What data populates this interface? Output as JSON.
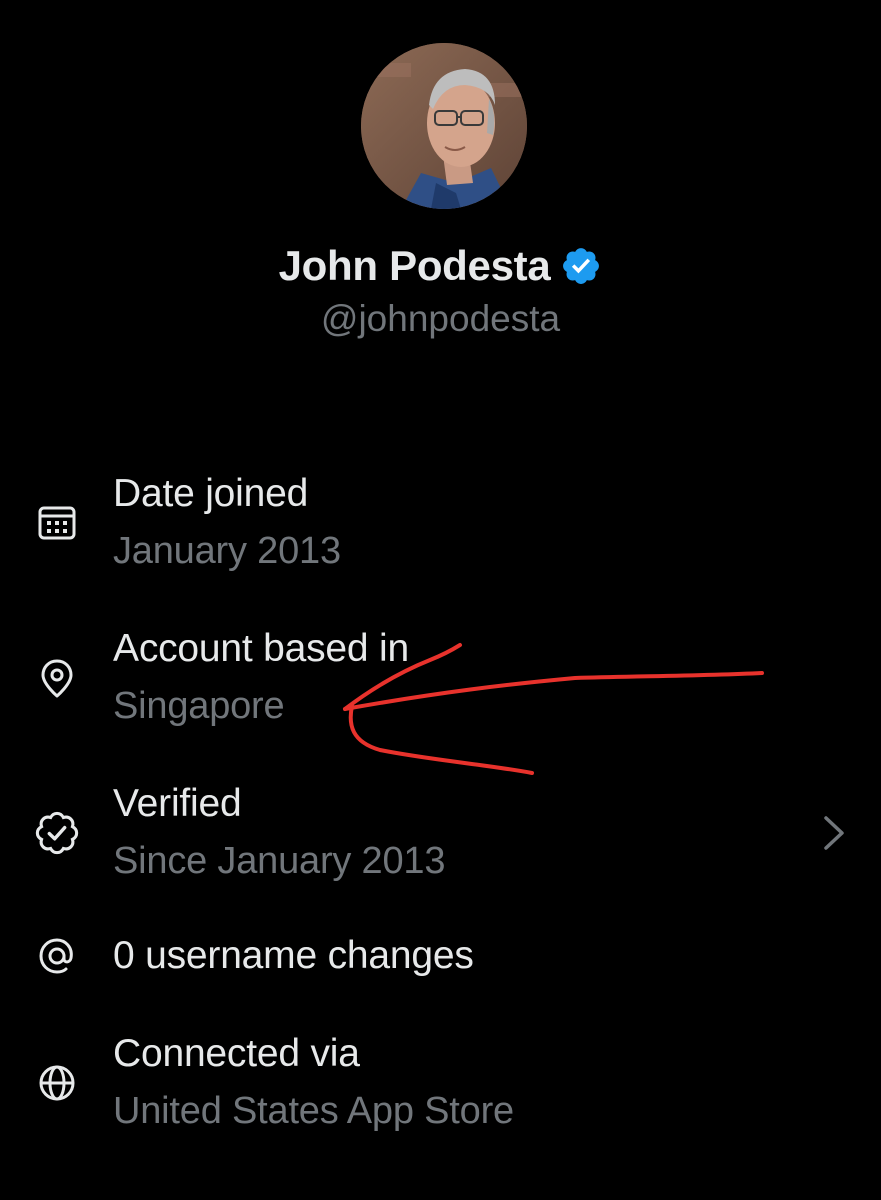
{
  "profile": {
    "display_name": "John Podesta",
    "handle": "@johnpodesta",
    "verified_badge_icon": "verified-badge-icon",
    "verified_color": "#1d9bf0"
  },
  "info": {
    "date_joined": {
      "icon": "calendar-icon",
      "label": "Date joined",
      "value": "January 2013"
    },
    "account_based_in": {
      "icon": "location-pin-icon",
      "label": "Account based in",
      "value": "Singapore"
    },
    "verified": {
      "icon": "verified-seal-icon",
      "label": "Verified",
      "value": "Since January 2013",
      "chevron_icon": "chevron-right-icon"
    },
    "username_changes": {
      "icon": "at-sign-icon",
      "label": "0 username changes"
    },
    "connected_via": {
      "icon": "globe-icon",
      "label": "Connected via",
      "value": "United States App Store"
    }
  },
  "annotation": {
    "type": "red-arrow",
    "color": "#e8322c"
  },
  "theme": {
    "background": "#000000",
    "primary_text": "#e7e9ea",
    "secondary_text": "#71767b"
  }
}
